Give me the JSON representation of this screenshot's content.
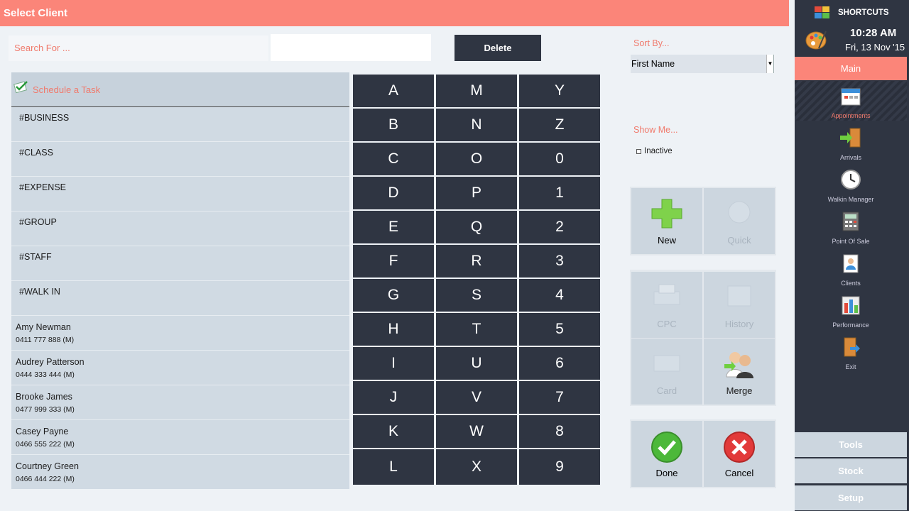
{
  "title": "Select Client",
  "search": {
    "label": "Search For ...",
    "value": ""
  },
  "delete_label": "Delete",
  "schedule_task": "Schedule a Task",
  "tags": [
    "#BUSINESS",
    "#CLASS",
    "#EXPENSE",
    "#GROUP",
    "#STAFF",
    "#WALK IN"
  ],
  "clients": [
    {
      "name": "Amy  Newman",
      "phone": "0411 777 888 (M)"
    },
    {
      "name": "Audrey  Patterson",
      "phone": "0444 333 444 (M)"
    },
    {
      "name": "Brooke  James",
      "phone": "0477 999 333 (M)"
    },
    {
      "name": "Casey  Payne",
      "phone": "0466 555 222 (M)"
    },
    {
      "name": "Courtney  Green",
      "phone": "0466 444 222 (M)"
    }
  ],
  "keys": [
    "A",
    "M",
    "Y",
    "B",
    "N",
    "Z",
    "C",
    "O",
    "0",
    "D",
    "P",
    "1",
    "E",
    "Q",
    "2",
    "F",
    "R",
    "3",
    "G",
    "S",
    "4",
    "H",
    "T",
    "5",
    "I",
    "U",
    "6",
    "J",
    "V",
    "7",
    "K",
    "W",
    "8",
    "L",
    "X",
    "9"
  ],
  "sort": {
    "label": "Sort By...",
    "value": "First Name"
  },
  "show": {
    "label": "Show Me...",
    "inactive": "Inactive"
  },
  "tiles": {
    "new": "New",
    "quick": "Quick",
    "cpc": "CPC",
    "history": "History",
    "card": "Card",
    "merge": "Merge",
    "done": "Done",
    "cancel": "Cancel"
  },
  "sidebar": {
    "shortcuts": "SHORTCUTS",
    "time": "10:28 AM",
    "date": "Fri, 13 Nov '15",
    "main": "Main",
    "items": [
      {
        "label": "Appointments"
      },
      {
        "label": "Arrivals"
      },
      {
        "label": "Walkin Manager"
      },
      {
        "label": "Point Of Sale"
      },
      {
        "label": "Clients"
      },
      {
        "label": "Performance"
      },
      {
        "label": "Exit"
      }
    ],
    "tools": "Tools",
    "stock": "Stock",
    "setup": "Setup"
  },
  "colors": {
    "accent": "#fb8579",
    "dark": "#2f3542",
    "label": "#f07a6c",
    "panel": "#ccd6df"
  }
}
